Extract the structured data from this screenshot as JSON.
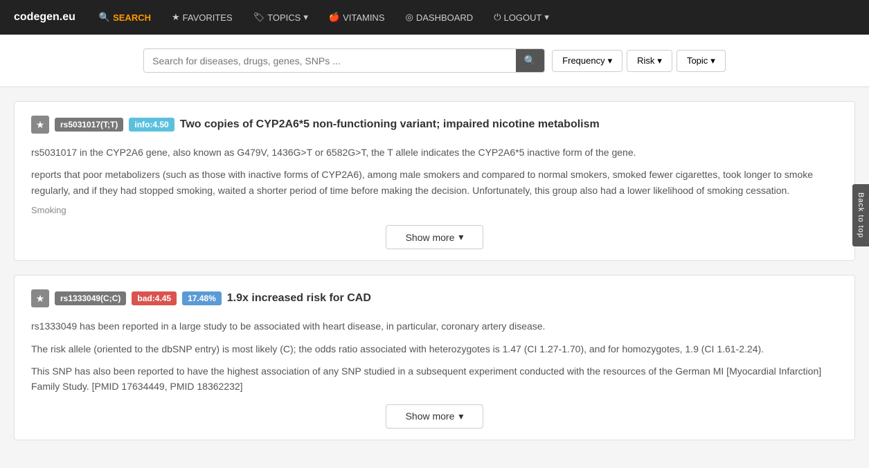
{
  "site": {
    "logo": "codegen.eu",
    "nav": [
      {
        "label": "SEARCH",
        "icon": "🔍",
        "active": true,
        "id": "search"
      },
      {
        "label": "FAVORITES",
        "icon": "★",
        "active": false,
        "id": "favorites"
      },
      {
        "label": "TOPICS",
        "icon": "🏷",
        "active": false,
        "id": "topics",
        "dropdown": true
      },
      {
        "label": "VITAMINS",
        "icon": "🍎",
        "active": false,
        "id": "vitamins"
      },
      {
        "label": "DASHBOARD",
        "icon": "◎",
        "active": false,
        "id": "dashboard"
      },
      {
        "label": "LOGOUT",
        "icon": "⏻",
        "active": false,
        "id": "logout",
        "dropdown": true
      }
    ]
  },
  "search": {
    "placeholder": "Search for diseases, drugs, genes, SNPs ...",
    "value": ""
  },
  "filters": {
    "frequency": "Frequency",
    "risk": "Risk",
    "topic": "Topic"
  },
  "back_to_top": "Back to top",
  "cards": [
    {
      "id": "card-1",
      "snp_label": "rs5031017(T;T)",
      "info_label": "info:4.50",
      "title": "Two copies of CYP2A6*5 non-functioning variant; impaired nicotine metabolism",
      "paragraphs": [
        "rs5031017    in the CYP2A6 gene, also known as G479V, 1436G>T or 6582G>T, the T allele indicates the CYP2A6*5 inactive form of the gene.",
        "reports that poor metabolizers (such as those with inactive forms of CYP2A6), among male smokers and compared to normal smokers, smoked fewer cigarettes, took longer to smoke regularly, and if they had stopped smoking, waited a shorter period of time before making the decision. Unfortunately, this group also had a lower likelihood of smoking cessation."
      ],
      "topic": "Smoking",
      "show_more": "Show more",
      "badge_type": "info"
    },
    {
      "id": "card-2",
      "snp_label": "rs1333049(C;C)",
      "bad_label": "bad:4.45",
      "pct_label": "17.48%",
      "title": "1.9x increased risk for CAD",
      "paragraphs": [
        "rs1333049    has been reported in a large study to be associated with heart disease, in particular, coronary artery disease.",
        "The risk allele (oriented to the dbSNP entry) is most likely (C); the odds ratio associated with heterozygotes is 1.47 (CI 1.27-1.70), and for homozygotes, 1.9 (CI 1.61-2.24).",
        "This SNP has also been reported to have the highest association of any SNP studied in a subsequent experiment conducted with the resources of the German MI [Myocardial Infarction] Family Study. [PMID 17634449, PMID 18362232]"
      ],
      "show_more": "Show more",
      "badge_type": "bad"
    }
  ]
}
